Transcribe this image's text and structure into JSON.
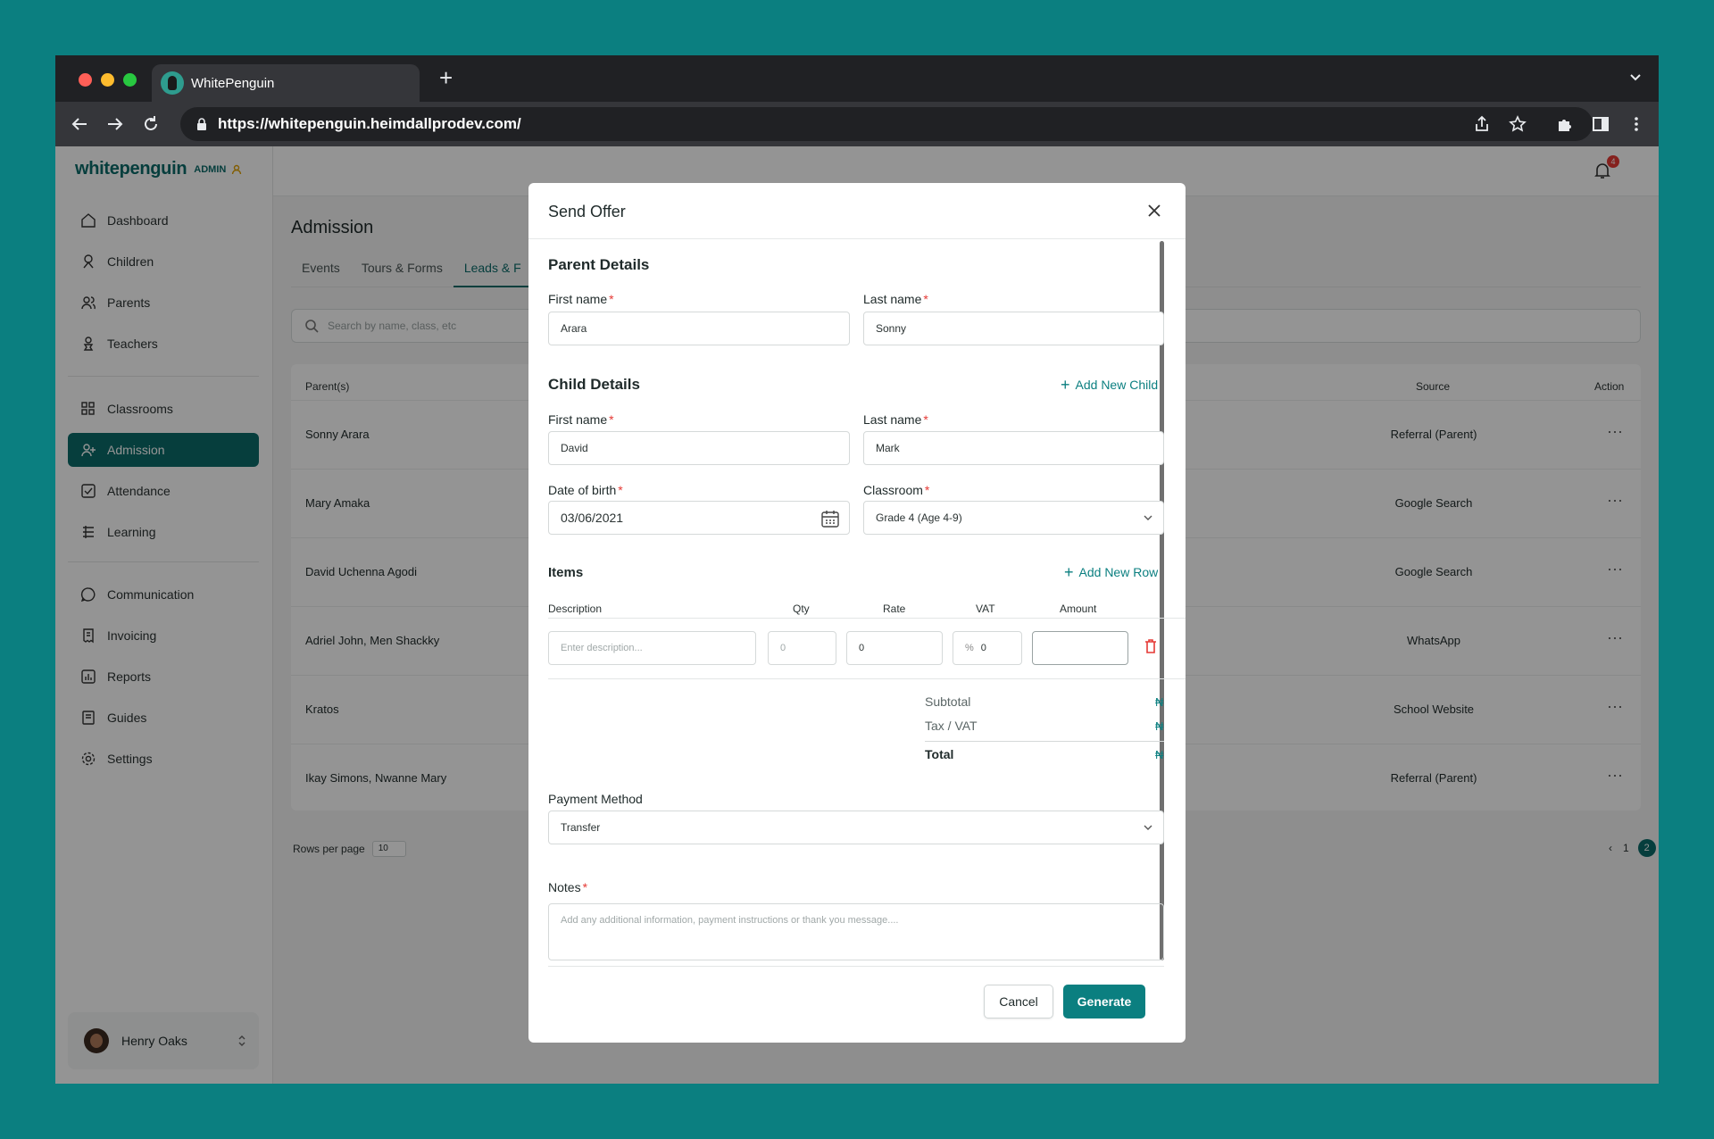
{
  "browser": {
    "tab_title": "WhitePenguin",
    "new_tab": "+",
    "url": "https://whitepenguin.heimdallprodev.com/"
  },
  "sidebar": {
    "logo": "whitepenguin",
    "logo_badge": "ADMIN",
    "items": [
      {
        "label": "Dashboard",
        "icon": "home-icon"
      },
      {
        "label": "Children",
        "icon": "child-icon"
      },
      {
        "label": "Parents",
        "icon": "users-icon"
      },
      {
        "label": "Teachers",
        "icon": "teacher-icon"
      },
      {
        "label": "Classrooms",
        "icon": "grid-icon"
      },
      {
        "label": "Admission",
        "icon": "user-plus-icon",
        "active": true
      },
      {
        "label": "Attendance",
        "icon": "check-square-icon"
      },
      {
        "label": "Learning",
        "icon": "list-icon"
      },
      {
        "label": "Communication",
        "icon": "chat-icon"
      },
      {
        "label": "Invoicing",
        "icon": "receipt-icon"
      },
      {
        "label": "Reports",
        "icon": "chart-icon"
      },
      {
        "label": "Guides",
        "icon": "book-icon"
      },
      {
        "label": "Settings",
        "icon": "gear-icon"
      }
    ],
    "user": {
      "name": "Henry Oaks"
    }
  },
  "topbar": {
    "notification_count": "4"
  },
  "page": {
    "title": "Admission",
    "tabs": [
      "Events",
      "Tours & Forms",
      "Leads & F"
    ],
    "search_placeholder": "Search by name, class, etc",
    "table": {
      "headers": {
        "parent": "Parent(s)",
        "source": "Source",
        "action": "Action"
      },
      "rows": [
        {
          "parent": "Sonny Arara",
          "source": "Referral (Parent)"
        },
        {
          "parent": "Mary Amaka",
          "source": "Google Search"
        },
        {
          "parent": "David Uchenna Agodi",
          "source": "Google Search"
        },
        {
          "parent": "Adriel John, Men Shackky",
          "source": "WhatsApp"
        },
        {
          "parent": "Kratos",
          "source": "School Website"
        },
        {
          "parent": "Ikay Simons, Nwanne Mary",
          "source": "Referral (Parent)"
        }
      ],
      "action_glyph": "···"
    },
    "rows_per_page_label": "Rows per page",
    "rows_per_page_value": "10",
    "pagination": {
      "prev": "‹",
      "page1": "1",
      "page2": "2",
      "next": "›"
    }
  },
  "modal": {
    "title": "Send Offer",
    "parent_section": "Parent Details",
    "parent_first_label": "First name",
    "parent_first_value": "Arara",
    "parent_last_label": "Last name",
    "parent_last_value": "Sonny",
    "child_section": "Child Details",
    "add_child": "Add New Child",
    "child_first_label": "First name",
    "child_first_value": "David",
    "child_last_label": "Last name",
    "child_last_value": "Mark",
    "dob_label": "Date of birth",
    "dob_value": "03/06/2021",
    "classroom_label": "Classroom",
    "classroom_value": "Grade 4 (Age 4-9)",
    "items_section": "Items",
    "add_row": "Add New Row",
    "cols": {
      "description": "Description",
      "qty": "Qty",
      "rate": "Rate",
      "vat": "VAT",
      "amount": "Amount"
    },
    "item": {
      "description_placeholder": "Enter description...",
      "qty_placeholder": "0",
      "rate": "0",
      "vat_prefix": "%",
      "vat": "0",
      "amount": ""
    },
    "subtotal_label": "Subtotal",
    "tax_label": "Tax / VAT",
    "total_label": "Total",
    "currency": "₦",
    "payment_label": "Payment Method",
    "payment_value": "Transfer",
    "notes_label": "Notes",
    "notes_placeholder": "Add any additional information, payment instructions or thank you message....",
    "cancel": "Cancel",
    "generate": "Generate"
  }
}
